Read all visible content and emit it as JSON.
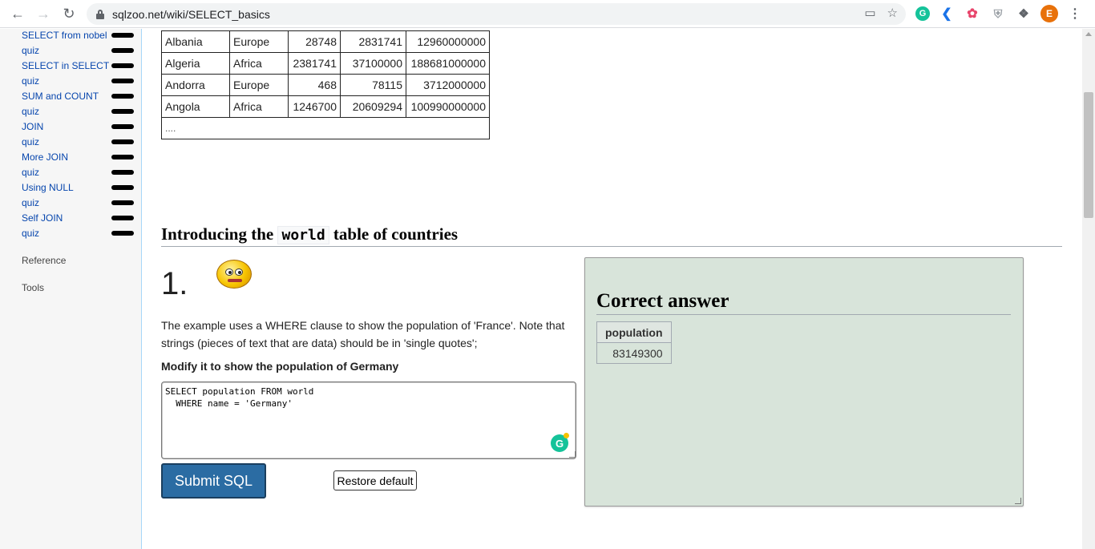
{
  "browser": {
    "url": "sqlzoo.net/wiki/SELECT_basics",
    "avatar_letter": "E",
    "grammarly_letter": "G"
  },
  "sidebar": {
    "items": [
      {
        "label": "SELECT from nobel"
      },
      {
        "label": "quiz"
      },
      {
        "label": "SELECT in SELECT"
      },
      {
        "label": "quiz"
      },
      {
        "label": "SUM and COUNT"
      },
      {
        "label": "quiz"
      },
      {
        "label": "JOIN"
      },
      {
        "label": "quiz"
      },
      {
        "label": "More JOIN"
      },
      {
        "label": "quiz"
      },
      {
        "label": "Using NULL"
      },
      {
        "label": "quiz"
      },
      {
        "label": "Self JOIN"
      },
      {
        "label": "quiz"
      }
    ],
    "reference": "Reference",
    "tools": "Tools"
  },
  "world_table": {
    "rows": [
      [
        "Albania",
        "Europe",
        "28748",
        "2831741",
        "12960000000"
      ],
      [
        "Algeria",
        "Africa",
        "2381741",
        "37100000",
        "188681000000"
      ],
      [
        "Andorra",
        "Europe",
        "468",
        "78115",
        "3712000000"
      ],
      [
        "Angola",
        "Africa",
        "1246700",
        "20609294",
        "100990000000"
      ]
    ],
    "ellipsis": "...."
  },
  "section": {
    "title_before": "Introducing the",
    "title_code": "world",
    "title_after": "table of countries"
  },
  "question": {
    "number": "1.",
    "description": "The example uses a WHERE clause to show the population of 'France'. Note that strings (pieces of text that are data) should be in 'single quotes';",
    "instruction": "Modify it to show the population of Germany",
    "sql": "SELECT population FROM world\n  WHERE name = 'Germany'",
    "submit_label": "Submit SQL",
    "restore_label": "Restore default"
  },
  "answer": {
    "title": "Correct answer",
    "header": "population",
    "value": "83149300"
  }
}
